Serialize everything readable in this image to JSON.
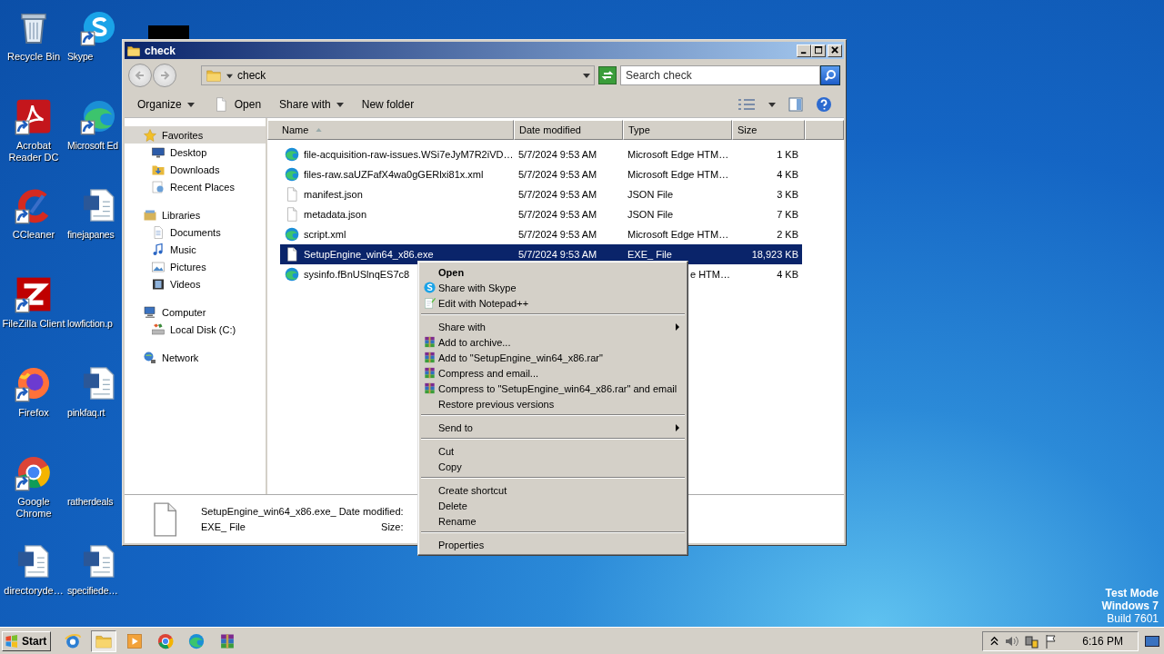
{
  "desktop_icons": [
    {
      "label": "Recycle Bin",
      "shortcut": false
    },
    {
      "label": "Acrobat Reader DC",
      "shortcut": true
    },
    {
      "label": "CCleaner",
      "shortcut": true
    },
    {
      "label": "FileZilla Client",
      "shortcut": true
    },
    {
      "label": "Firefox",
      "shortcut": true
    },
    {
      "label": "Google Chrome",
      "shortcut": true
    },
    {
      "label": "directoryde…",
      "shortcut": false
    },
    {
      "label": "Skype",
      "shortcut": true
    },
    {
      "label": "Microsoft Ed",
      "shortcut": true
    },
    {
      "label": "finejapanes",
      "shortcut": false
    },
    {
      "label": "lowfiction.p"
    },
    {
      "label": "pinkfaq.rt",
      "shortcut": false
    },
    {
      "label": "ratherdeals"
    },
    {
      "label": "specifiede…",
      "shortcut": false
    }
  ],
  "window": {
    "title": "check",
    "address": "check",
    "search": {
      "placeholder": "Search check"
    },
    "toolbar": [
      {
        "label": "Organize",
        "dropdown": true
      },
      {
        "label": "Open",
        "dropdown": false
      },
      {
        "label": "Share with",
        "dropdown": true
      },
      {
        "label": "New folder",
        "dropdown": false
      }
    ],
    "nav": [
      {
        "label": "Favorites",
        "selected": true,
        "children": [
          {
            "label": "Desktop",
            "selected": false
          },
          {
            "label": "Downloads",
            "selected": false
          },
          {
            "label": "Recent Places",
            "selected": false
          }
        ]
      },
      {
        "label": "Libraries",
        "selected": false,
        "children": [
          {
            "label": "Documents",
            "selected": false
          },
          {
            "label": "Music",
            "selected": false
          },
          {
            "label": "Pictures",
            "selected": false
          },
          {
            "label": "Videos",
            "selected": false
          }
        ]
      },
      {
        "label": "Computer",
        "selected": false,
        "children": [
          {
            "label": "Local Disk (C:)",
            "selected": false
          }
        ]
      },
      {
        "label": "Network",
        "selected": false
      }
    ],
    "columns": [
      {
        "label": "Name",
        "sorted": true
      },
      {
        "label": "Date modified",
        "sorted": false
      },
      {
        "label": "Type",
        "sorted": false
      },
      {
        "label": "Size",
        "sorted": false
      }
    ],
    "rows": [
      {
        "kind": "web",
        "name": "file-acquisition-raw-issues.WSi7eJyM7R2iVD…",
        "date": "5/7/2024 9:53 AM",
        "type": "Microsoft Edge HTM…",
        "size": "1 KB",
        "selected": false,
        "covered": false
      },
      {
        "kind": "web",
        "name": "files-raw.saUZFafX4wa0gGERlxi81x.xml",
        "date": "5/7/2024 9:53 AM",
        "type": "Microsoft Edge HTM…",
        "size": "4 KB",
        "selected": false,
        "covered": false
      },
      {
        "kind": "plain",
        "name": "manifest.json",
        "date": "5/7/2024 9:53 AM",
        "type": "JSON File",
        "size": "3 KB",
        "selected": false,
        "covered": false
      },
      {
        "kind": "plain",
        "name": "metadata.json",
        "date": "5/7/2024 9:53 AM",
        "type": "JSON File",
        "size": "7 KB",
        "selected": false,
        "covered": false
      },
      {
        "kind": "web",
        "name": "script.xml",
        "date": "5/7/2024 9:53 AM",
        "type": "Microsoft Edge HTM…",
        "size": "2 KB",
        "selected": false,
        "covered": false
      },
      {
        "kind": "plain",
        "name": "SetupEngine_win64_x86.exe",
        "date": "5/7/2024 9:53 AM",
        "type": "EXE_ File",
        "size": "18,923 KB",
        "selected": true,
        "covered": false
      },
      {
        "kind": "web",
        "name": "sysinfo.fBnUSlnqES7c8",
        "type": "e HTM…",
        "size": "4 KB",
        "selected": false,
        "covered": true
      }
    ],
    "details": {
      "name": "SetupEngine_win64_x86.exe_",
      "type": "EXE_ File",
      "date_label": "Date modified:",
      "size_label": "Size:"
    }
  },
  "context_menu": {
    "groups": [
      [
        {
          "label": "Open",
          "default": true,
          "submenu": false
        },
        {
          "label": "Share with Skype",
          "default": false,
          "submenu": false
        },
        {
          "label": "Edit with Notepad++",
          "default": false,
          "submenu": false
        }
      ],
      [
        {
          "label": "Share with",
          "default": false,
          "submenu": true
        },
        {
          "label": "Add to archive...",
          "default": false,
          "submenu": false
        },
        {
          "label": "Add to \"SetupEngine_win64_x86.rar\"",
          "default": false,
          "submenu": false
        },
        {
          "label": "Compress and email...",
          "default": false,
          "submenu": false
        },
        {
          "label": "Compress to \"SetupEngine_win64_x86.rar\" and email",
          "default": false,
          "submenu": false
        },
        {
          "label": "Restore previous versions",
          "default": false,
          "submenu": false
        }
      ],
      [
        {
          "label": "Send to",
          "default": false,
          "submenu": true
        }
      ],
      [
        {
          "label": "Cut",
          "default": false,
          "submenu": false
        },
        {
          "label": "Copy",
          "default": false,
          "submenu": false
        }
      ],
      [
        {
          "label": "Create shortcut",
          "default": false,
          "submenu": false
        },
        {
          "label": "Delete",
          "default": false,
          "submenu": false
        },
        {
          "label": "Rename",
          "default": false,
          "submenu": false
        }
      ],
      [
        {
          "label": "Properties",
          "default": false,
          "submenu": false
        }
      ]
    ]
  },
  "taskbar": {
    "start": "Start",
    "apps": [
      {
        "selected": false
      },
      {
        "selected": true
      },
      {
        "selected": false
      },
      {
        "selected": false
      },
      {
        "selected": false
      },
      {
        "selected": false
      }
    ],
    "time": "6:16 PM"
  },
  "os_notice": [
    "Test Mode",
    "Windows 7",
    "Build 7601"
  ]
}
